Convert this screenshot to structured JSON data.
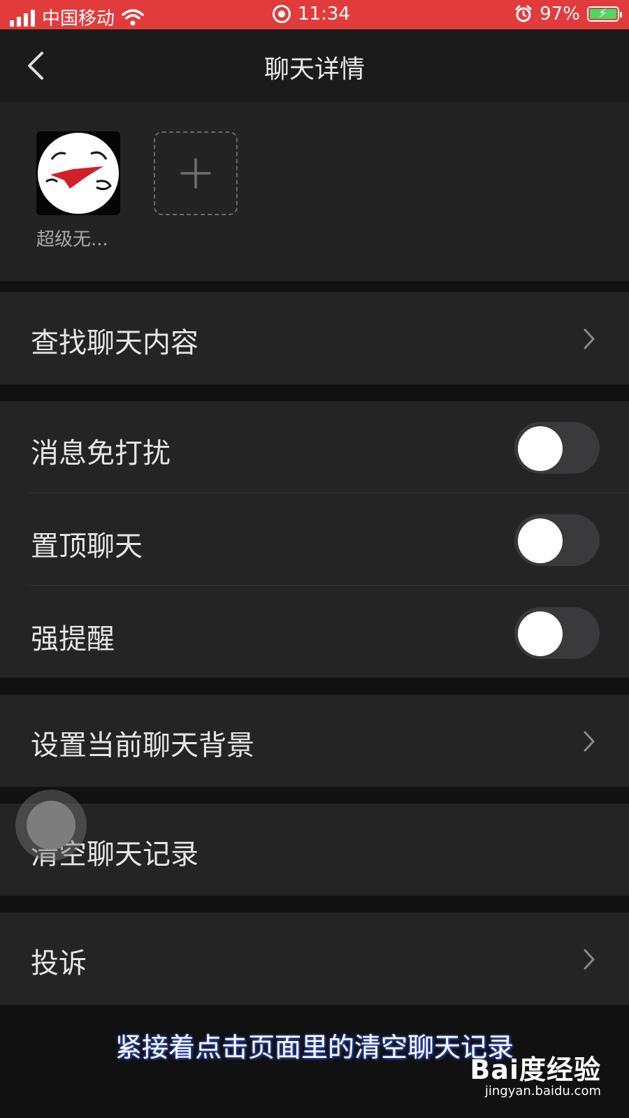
{
  "status_bar": {
    "carrier": "中国移动",
    "time": "11:34",
    "battery": "97%",
    "background_color": "#e23b3b"
  },
  "nav": {
    "title": "聊天详情"
  },
  "members": {
    "items": [
      {
        "name": "超级无..."
      }
    ]
  },
  "cells": {
    "search": "查找聊天内容",
    "mute": {
      "label": "消息免打扰",
      "on": false
    },
    "pin": {
      "label": "置顶聊天",
      "on": false
    },
    "strong_remind": {
      "label": "强提醒",
      "on": false
    },
    "background": "设置当前聊天背景",
    "clear_history": "清空聊天记录",
    "report": "投诉"
  },
  "overlay": {
    "caption": "紧接着点击页面里的清空聊天记录",
    "watermark_logo": "Bai度经验",
    "watermark_url": "jingyan.baidu.com"
  }
}
